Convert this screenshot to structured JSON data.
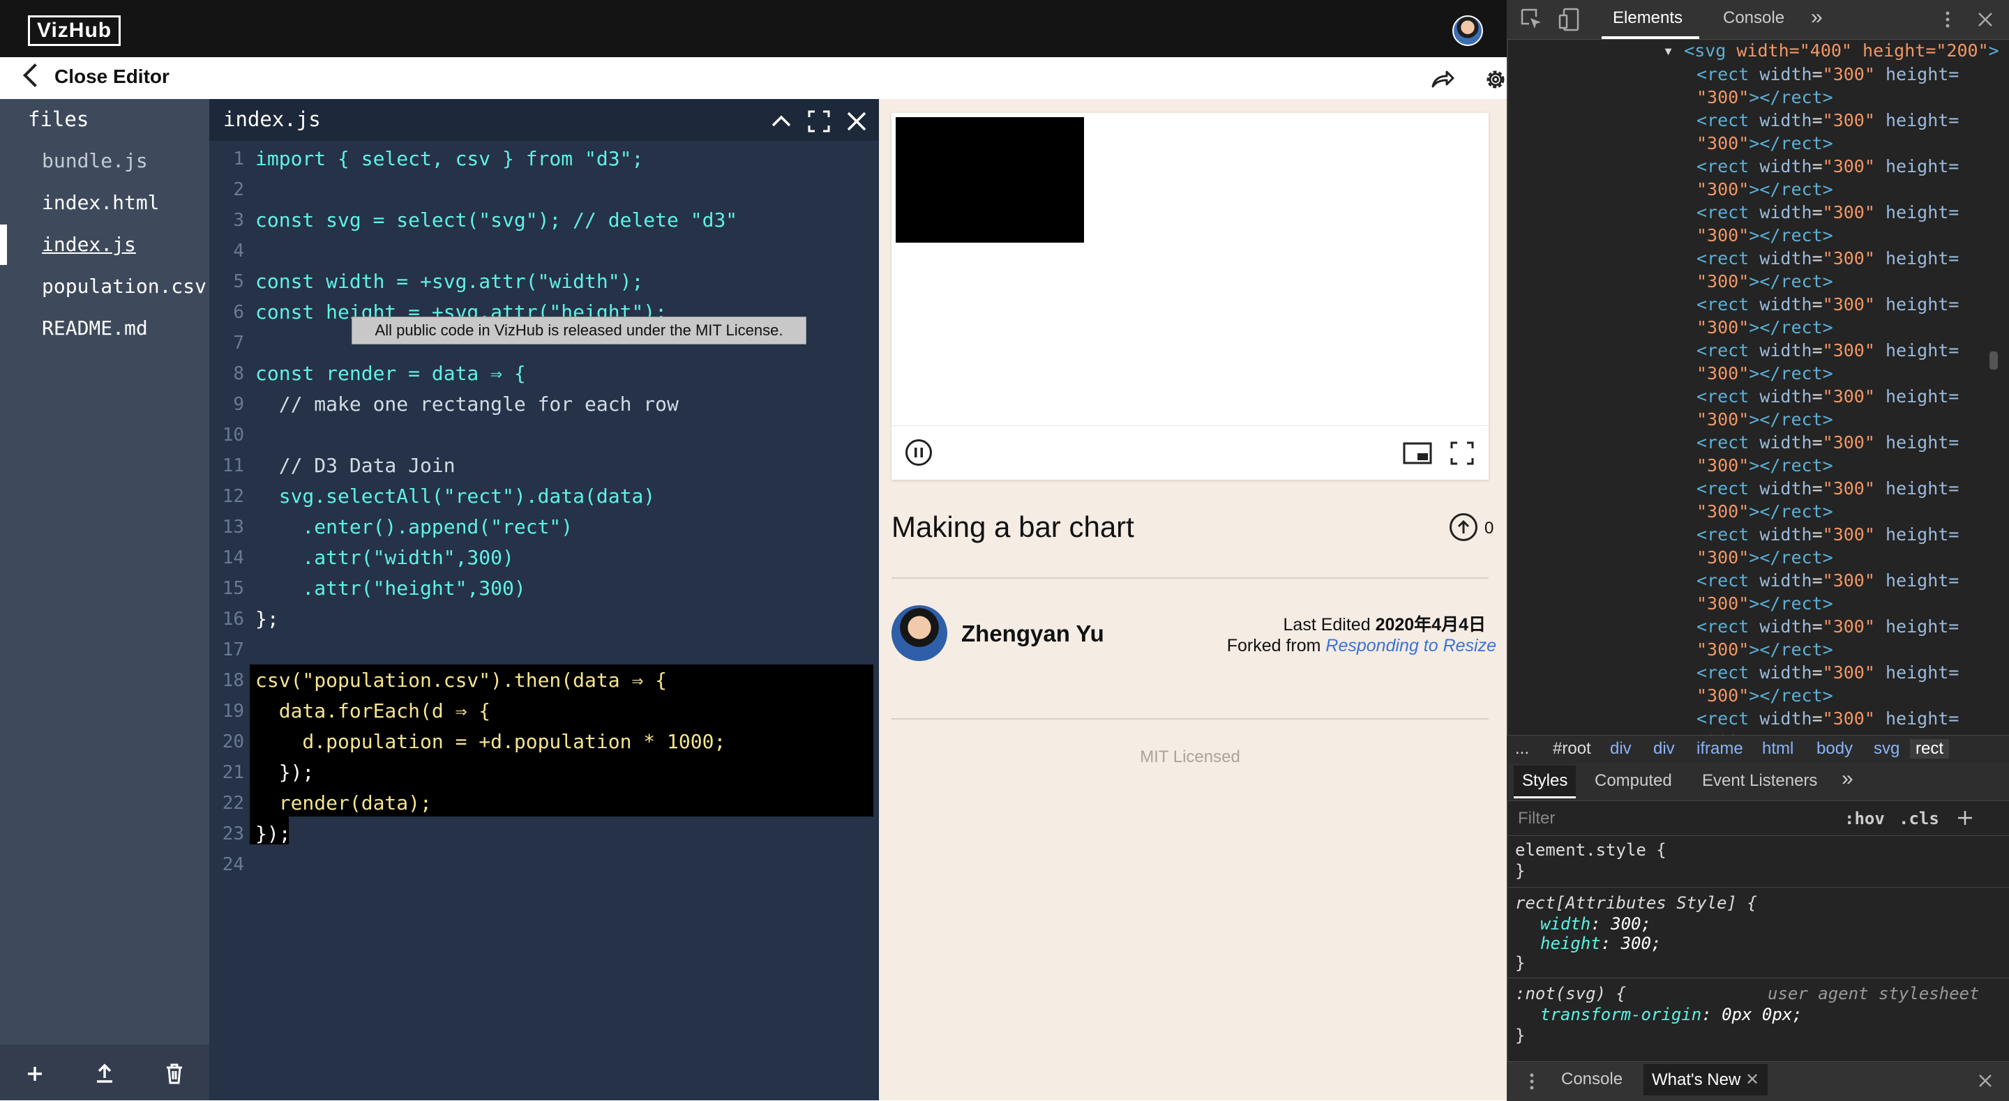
{
  "app": {
    "logo": "VizHub"
  },
  "editor_header": {
    "close_label": "Close Editor"
  },
  "sidebar": {
    "title": "files",
    "files": [
      {
        "name": "bundle.js"
      },
      {
        "name": "index.html"
      },
      {
        "name": "index.js"
      },
      {
        "name": "population.csv"
      },
      {
        "name": "README.md"
      }
    ]
  },
  "code_panel": {
    "filename": "index.js",
    "line_numbers": [
      "1",
      "2",
      "3",
      "4",
      "5",
      "6",
      "7",
      "8",
      "9",
      "10",
      "11",
      "12",
      "13",
      "14",
      "15",
      "16",
      "17",
      "18",
      "19",
      "20",
      "21",
      "22",
      "23",
      "24"
    ],
    "lines": [
      "import { select, csv } from \"d3\";",
      "",
      "const svg = select(\"svg\"); // delete \"d3\"",
      "",
      "const width = +svg.attr(\"width\");",
      "const height = +svg.attr(\"height\");",
      "",
      "const render = data ⇒ {",
      "  // make one rectangle for each row",
      "",
      "  // D3 Data Join",
      "  svg.selectAll(\"rect\").data(data)",
      "    .enter().append(\"rect\")",
      "    .attr(\"width\",300)",
      "    .attr(\"height\",300)",
      "};",
      "",
      "csv(\"population.csv\").then(data ⇒ {",
      "  data.forEach(d ⇒ {",
      "    d.population = +d.population * 1000;",
      "  });",
      "  render(data);",
      "});",
      ""
    ],
    "tooltip": "All public code in VizHub is released under the MIT License."
  },
  "viz": {
    "title": "Making a bar chart",
    "upvotes": "0",
    "author": "Zhengyan Yu",
    "last_edited_label": "Last Edited",
    "last_edited_date": "2020年4月4日",
    "forked_label": "Forked from",
    "forked_link": "Responding to Resize",
    "license": "MIT Licensed"
  },
  "devtools": {
    "tabs": [
      "Elements",
      "Console",
      "»"
    ],
    "dom_open": {
      "tag": "svg",
      "attrs": "width=\"400\" height=\"200\""
    },
    "rect_line": {
      "tag": "rect",
      "w_attr": "width",
      "w_val": "\"300\"",
      "h_attr": "height=",
      "h_val": "\"300\"",
      "close": "></rect>"
    },
    "rect_count": 15,
    "breadcrumbs": [
      "...",
      "#root",
      "div",
      "div",
      "iframe",
      "html",
      "body",
      "svg",
      "rect"
    ],
    "styles_tabs": [
      "Styles",
      "Computed",
      "Event Listeners",
      "»"
    ],
    "filter_placeholder": "Filter",
    "hov": ":hov",
    "cls": ".cls",
    "rules": {
      "element_style": "element.style {",
      "close": "}",
      "attr_selector": "rect[Attributes Style] {",
      "width_prop": "width",
      "width_val": "300;",
      "height_prop": "height",
      "height_val": "300;",
      "ua_selector": ":not(svg) {",
      "ua_label": "user agent stylesheet",
      "transform_prop": "transform-origin",
      "transform_val": "0px 0px;"
    },
    "drawer_tabs": [
      "Console",
      "What's New"
    ]
  }
}
